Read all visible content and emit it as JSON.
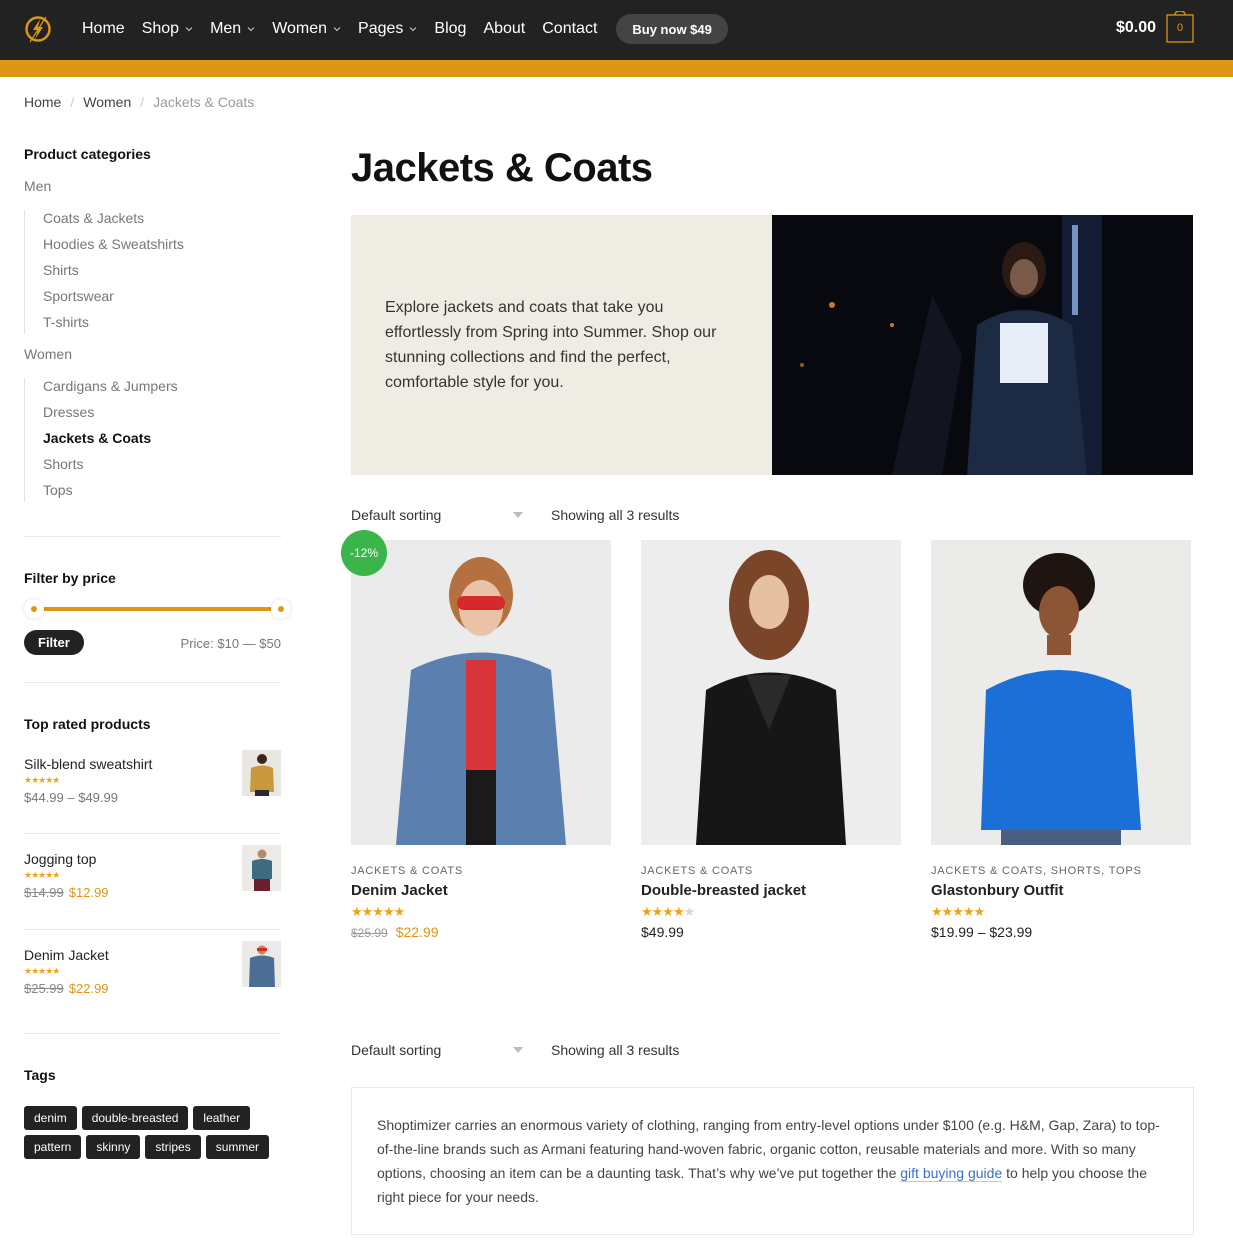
{
  "header": {
    "nav": [
      {
        "label": "Home",
        "has_dropdown": false
      },
      {
        "label": "Shop",
        "has_dropdown": true
      },
      {
        "label": "Men",
        "has_dropdown": true
      },
      {
        "label": "Women",
        "has_dropdown": true
      },
      {
        "label": "Pages",
        "has_dropdown": true
      },
      {
        "label": "Blog",
        "has_dropdown": false
      },
      {
        "label": "About",
        "has_dropdown": false
      },
      {
        "label": "Contact",
        "has_dropdown": false
      }
    ],
    "buy_button": "Buy now $49",
    "cart_total": "$0.00",
    "cart_count": "0",
    "accent_color": "#dc9814"
  },
  "breadcrumb": [
    "Home",
    "Women",
    "Jackets & Coats"
  ],
  "sidebar": {
    "categories_title": "Product categories",
    "groups": [
      {
        "label": "Men",
        "children": [
          "Coats & Jackets",
          "Hoodies & Sweatshirts",
          "Shirts",
          "Sportswear",
          "T-shirts"
        ]
      },
      {
        "label": "Women",
        "children": [
          "Cardigans & Jumpers",
          "Dresses",
          "Jackets & Coats",
          "Shorts",
          "Tops"
        ]
      }
    ],
    "active_category": "Jackets & Coats",
    "filter_title": "Filter by price",
    "filter_button": "Filter",
    "price_label": "Price: $10 — $50",
    "price_min": 10,
    "price_max": 50,
    "top_rated_title": "Top rated products",
    "top_rated": [
      {
        "name": "Silk-blend sweatshirt",
        "rating": 5,
        "price": "$44.99 – $49.99",
        "old_price": "",
        "sale_price": ""
      },
      {
        "name": "Jogging top",
        "rating": 5,
        "price": "",
        "old_price": "$14.99",
        "sale_price": "$12.99"
      },
      {
        "name": "Denim Jacket",
        "rating": 5,
        "price": "",
        "old_price": "$25.99",
        "sale_price": "$22.99"
      }
    ],
    "tags_title": "Tags",
    "tags": [
      "denim",
      "double-breasted",
      "leather",
      "pattern",
      "skinny",
      "stripes",
      "summer"
    ]
  },
  "main": {
    "title": "Jackets & Coats",
    "hero_text": "Explore jackets and coats that take you effortlessly from Spring into Summer. Shop our stunning collections and find the perfect, comfortable style for you.",
    "sorting": "Default sorting",
    "results": "Showing all 3 results",
    "sale_badge": "-12%",
    "products": [
      {
        "category": "Jackets & Coats",
        "name": "Denim Jacket",
        "rating": 5,
        "price": "",
        "old_price": "$25.99",
        "sale_price": "$22.99"
      },
      {
        "category": "Jackets & Coats",
        "name": "Double-breasted jacket",
        "rating": 4,
        "price": "$49.99",
        "old_price": "",
        "sale_price": ""
      },
      {
        "category": "Jackets & Coats, Shorts, Tops",
        "name": "Glastonbury Outfit",
        "rating": 5,
        "price": "$19.99 – $23.99",
        "old_price": "",
        "sale_price": ""
      }
    ],
    "description_before": "Shoptimizer carries an enormous variety of clothing, ranging from entry-level options under $100 (e.g. H&M, Gap, Zara) to top-of-the-line brands such as Armani featuring hand-woven fabric, organic cotton, reusable materials and more. With so many options, choosing an item can be a daunting task. That’s why we’ve put together the ",
    "description_link": "gift buying guide",
    "description_after": " to help you choose the right piece for your needs."
  }
}
